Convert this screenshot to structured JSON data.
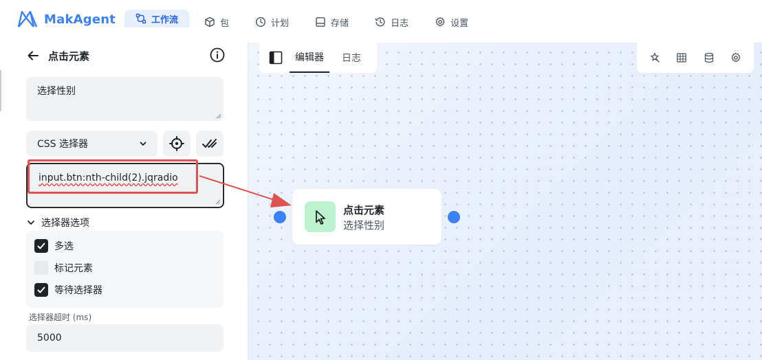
{
  "app": {
    "name": "MakAgent",
    "brand_color": "#3b82f6"
  },
  "nav": [
    {
      "label": "工作流",
      "icon": "workflow-icon",
      "active": true
    },
    {
      "label": "包",
      "icon": "package-icon"
    },
    {
      "label": "计划",
      "icon": "clock-icon"
    },
    {
      "label": "存储",
      "icon": "storage-icon"
    },
    {
      "label": "日志",
      "icon": "history-icon"
    },
    {
      "label": "设置",
      "icon": "gear-icon"
    }
  ],
  "panel": {
    "title": "点击元素",
    "description": "选择性别",
    "selector_type": "CSS 选择器",
    "selector_value": "input.btn:nth-child(2).jqradio",
    "options_heading": "选择器选项",
    "options": [
      {
        "label": "多选",
        "checked": true
      },
      {
        "label": "标记元素",
        "checked": false
      },
      {
        "label": "等待选择器",
        "checked": true
      }
    ],
    "timeout_label": "选择器超时 (ms)",
    "timeout_value": "5000"
  },
  "editor": {
    "tabs": [
      {
        "label": "编辑器",
        "active": true
      },
      {
        "label": "日志",
        "active": false
      }
    ],
    "tools": [
      "magic-icon",
      "table-icon",
      "database-icon",
      "gear-icon"
    ]
  },
  "node": {
    "title": "点击元素",
    "subtitle": "选择性别",
    "icon": "cursor-icon",
    "icon_bg": "#bdf2d0",
    "port_color": "#3b82f6"
  },
  "annotation": {
    "color": "#e05252"
  }
}
